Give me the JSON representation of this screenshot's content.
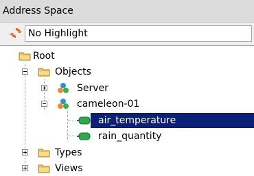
{
  "panel": {
    "title": "Address Space"
  },
  "toolbar": {
    "refresh_icon": "refresh-icon",
    "highlight_value": "No Highlight"
  },
  "tree": {
    "root": "Root",
    "objects": "Objects",
    "server": "Server",
    "cameleon": "cameleon-01",
    "air_temperature": "air_temperature",
    "rain_quantity": "rain_quantity",
    "types": "Types",
    "views": "Views"
  },
  "colors": {
    "selection": "#0b2175",
    "folder": "#e9c46a",
    "variable": "#2fa84f",
    "refresh": "#f05a1a"
  }
}
